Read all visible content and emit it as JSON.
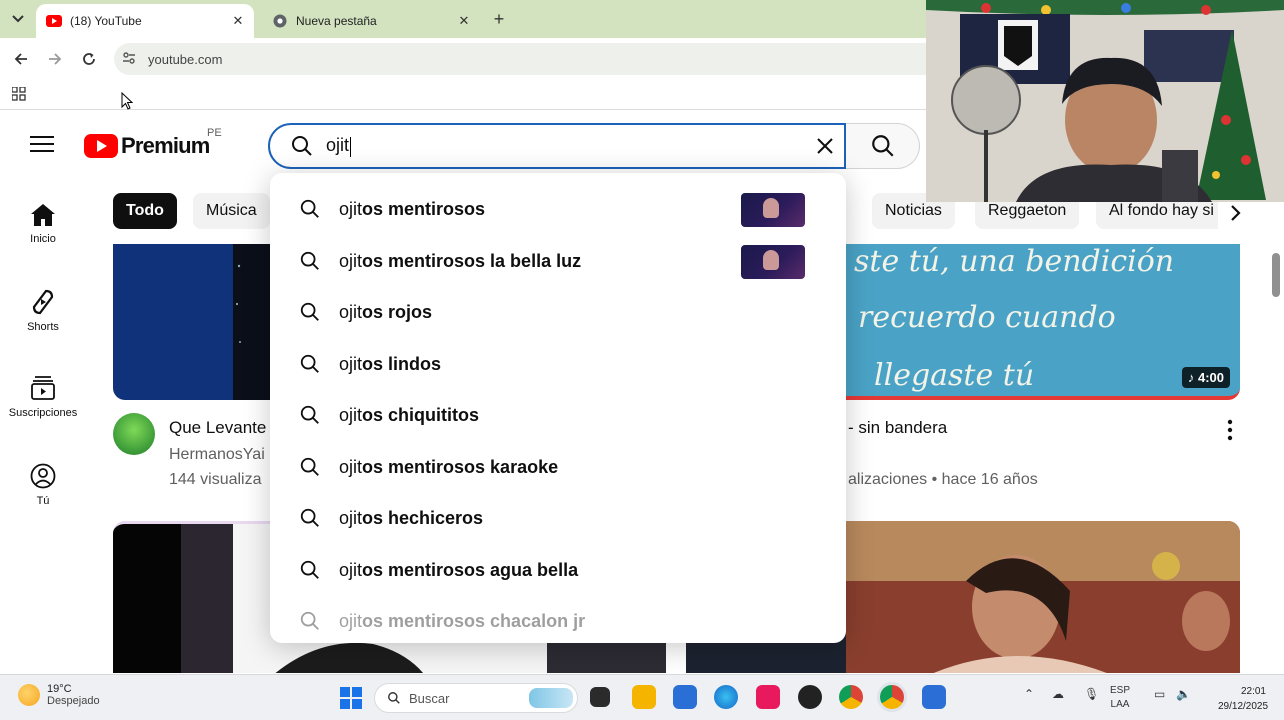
{
  "browser": {
    "tabs": [
      {
        "title": "(18) YouTube",
        "active": true
      },
      {
        "title": "Nueva pestaña",
        "active": false
      }
    ],
    "url": "youtube.com"
  },
  "youtube": {
    "logo_text": "Premium",
    "country_code": "PE",
    "search_query": "ojit",
    "guide": [
      "Inicio",
      "Shorts",
      "Suscripciones",
      "Tú"
    ],
    "chips": [
      "Todo",
      "Música",
      "Noticias",
      "Reggaeton",
      "Al fondo hay si"
    ],
    "suggestions": [
      {
        "prefix": "ojit",
        "rest": "os mentirosos"
      },
      {
        "prefix": "ojit",
        "rest": "os mentirosos la bella luz"
      },
      {
        "prefix": "ojit",
        "rest": "os rojos"
      },
      {
        "prefix": "ojit",
        "rest": "os lindos"
      },
      {
        "prefix": "ojit",
        "rest": "os chiquititos"
      },
      {
        "prefix": "ojit",
        "rest": "os mentirosos karaoke"
      },
      {
        "prefix": "ojit",
        "rest": "os hechiceros"
      },
      {
        "prefix": "ojit",
        "rest": "os mentirosos agua bella"
      },
      {
        "prefix": "ojit",
        "rest": "os mentirosos chacalon jr"
      }
    ],
    "videos": [
      {
        "title": "Que Levante",
        "channel": "HermanosYai",
        "meta": "144 visualiza"
      },
      {
        "title": "- sin bandera",
        "meta": "alizaciones • hace 16 años",
        "duration": "4:00",
        "lyrics": [
          "ste tú, una bendición",
          "recuerdo cuando",
          "llegaste tú"
        ]
      }
    ]
  },
  "taskbar": {
    "temperature": "19°C",
    "condition": "Despejado",
    "search_placeholder": "Buscar",
    "lang_1": "ESP",
    "lang_2": "LAA",
    "time": "22:01",
    "date": "29/12/2025"
  },
  "colors": {
    "accent_blue": "#1c62b9",
    "youtube_red": "#ff0000",
    "chrome_green": "#d3e3c0"
  }
}
